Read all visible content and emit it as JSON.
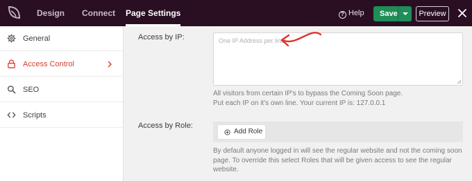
{
  "topbar": {
    "logo_icon": "seedprod-leaf-icon",
    "tabs": [
      {
        "label": "Design"
      },
      {
        "label": "Connect"
      },
      {
        "label": "Page Settings"
      }
    ],
    "help_label": "Help",
    "save_label": "Save",
    "preview_label": "Preview"
  },
  "sidebar": {
    "items": [
      {
        "label": "General",
        "icon": "gear-icon"
      },
      {
        "label": "Access Control",
        "icon": "lock-icon"
      },
      {
        "label": "SEO",
        "icon": "search-icon"
      },
      {
        "label": "Scripts",
        "icon": "code-icon"
      }
    ]
  },
  "main": {
    "ip": {
      "label": "Access by IP:",
      "placeholder": "One IP Address per line",
      "help_line1": "All visitors from certain IP's to bypass the Coming Soon page.",
      "help_line2": "Put each IP on it's own line. Your current IP is: 127.0.0.1"
    },
    "role": {
      "label": "Access by Role:",
      "add_role_label": "Add Role",
      "help_line1": "By default anyone logged in will see the regular website and not the coming soon",
      "help_line2": "page. To override this select Roles that will be given access to see the regular",
      "help_line3": "website."
    }
  },
  "colors": {
    "topbar_bg": "#2a0f23",
    "save_green": "#1f8e58",
    "active_red": "#d33c2f",
    "annotation_arrow": "#e2312b"
  }
}
